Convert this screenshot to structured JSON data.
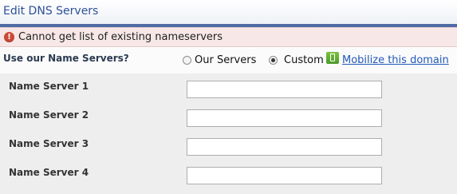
{
  "header": {
    "title": "Edit DNS Servers"
  },
  "error": {
    "icon": "error-icon",
    "message": "Cannot get list of existing nameservers"
  },
  "nameserver_choice": {
    "label": "Use our Name Servers?",
    "options": [
      {
        "label": "Our Servers",
        "selected": false
      },
      {
        "label": "Custom",
        "selected": true
      }
    ],
    "mobilize_icon": "mobile-phone-icon",
    "mobilize_link": "Mobilize this domain"
  },
  "name_servers": [
    {
      "label": "Name Server 1",
      "value": ""
    },
    {
      "label": "Name Server 2",
      "value": ""
    },
    {
      "label": "Name Server 3",
      "value": ""
    },
    {
      "label": "Name Server 4",
      "value": ""
    }
  ],
  "colors": {
    "title_text": "#2e5196",
    "title_rule": "#4f6aa6",
    "error_background": "#f7e7e7",
    "error_icon": "#cc4a37",
    "link": "#2258b8",
    "form_background": "#eeeeee"
  }
}
